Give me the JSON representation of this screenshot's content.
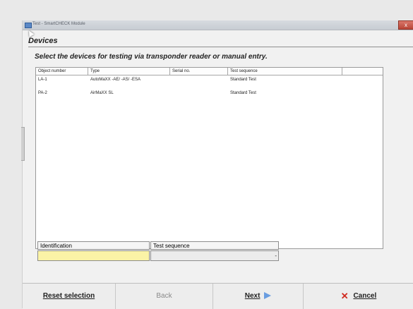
{
  "window": {
    "title": "Test - SmartCHECK Module",
    "close_label": "x"
  },
  "page": {
    "heading": "Devices",
    "subtitle": "Select the devices for testing  via transponder reader or manual entry."
  },
  "table": {
    "columns": [
      "Object number",
      "Type",
      "Serial no.",
      "Test sequence"
    ],
    "rows": [
      [
        "LA-1",
        "AutoMaXX -AE/ -AS/ -ESA",
        "",
        "Standard Test"
      ],
      [
        "PA-2",
        "AirMaXX SL",
        "",
        "Standard Test"
      ]
    ]
  },
  "form": {
    "identification_label": "Identification",
    "identification_value": "",
    "test_sequence_label": "Test sequence",
    "test_sequence_value": "",
    "dropdown_glyph": "-"
  },
  "footer": {
    "reset_label": "Reset selection",
    "back_label": "Back",
    "next_label": "Next",
    "cancel_label": "Cancel",
    "next_icon": "arrow-right-icon",
    "cancel_icon": "close-x-icon"
  }
}
